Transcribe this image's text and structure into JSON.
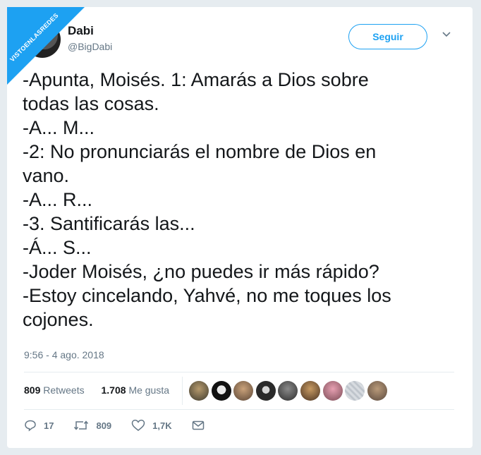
{
  "watermark": "VISTOENLASREDES",
  "tweet": {
    "author_name": "Dabi",
    "author_handle": "@BigDabi",
    "follow_label": "Seguir",
    "lines": [
      "-Apunta, Moisés. 1: Amarás a Dios sobre",
      "todas las cosas.",
      "-A... M...",
      "-2: No pronunciarás el nombre de Dios en",
      "vano.",
      "-A... R...",
      "-3. Santificarás las...",
      "-Á... S...",
      "-Joder Moisés, ¿no puedes ir más rápido?",
      "-Estoy cincelando, Yahvé, no me toques los",
      "cojones."
    ],
    "timestamp": "9:56 - 4 ago. 2018"
  },
  "stats": {
    "retweets_count": "809",
    "retweets_label": "Retweets",
    "likes_count": "1.708",
    "likes_label": "Me gusta"
  },
  "actions": {
    "replies": "17",
    "retweets": "809",
    "likes": "1,7K"
  },
  "colors": {
    "accent": "#1da1f2",
    "text": "#14171a",
    "muted": "#657786"
  },
  "icons": [
    "chevron-down-icon",
    "reply-icon",
    "retweet-icon",
    "heart-icon",
    "message-icon"
  ]
}
